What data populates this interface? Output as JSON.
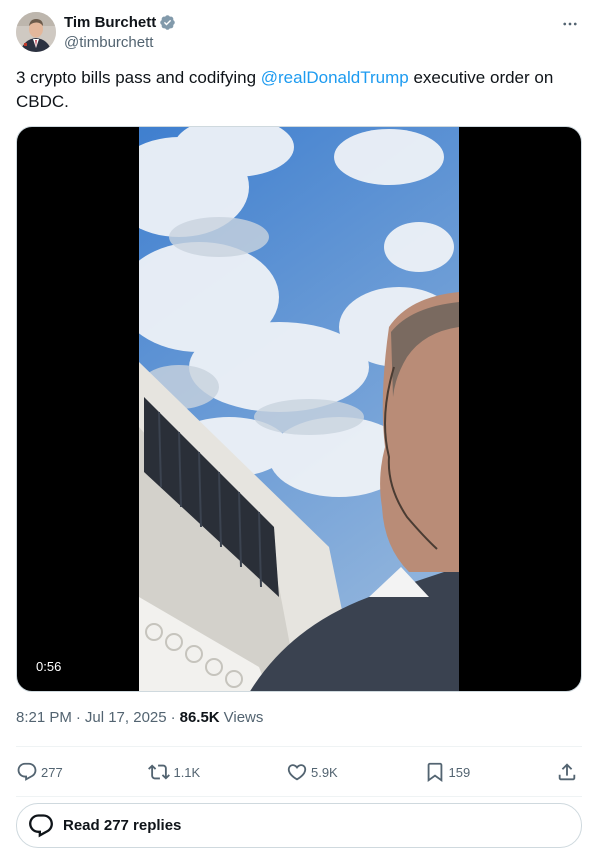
{
  "tweet": {
    "author": {
      "display_name": "Tim Burchett",
      "handle": "@timburchett",
      "verified": true
    },
    "text_before": "3 crypto bills pass and codifying ",
    "mention": "@realDonaldTrump",
    "text_after": " executive order on CBDC.",
    "video": {
      "duration": "0:56"
    },
    "meta": {
      "time": "8:21 PM",
      "sep1": "·",
      "date": "Jul 17, 2025",
      "sep2": "·",
      "views_count": "86.5K",
      "views_label": "Views"
    },
    "actions": {
      "replies": "277",
      "reposts": "1.1K",
      "likes": "5.9K",
      "bookmarks": "159"
    },
    "read_replies_label": "Read 277 replies"
  },
  "colors": {
    "accent": "#1d9bf0",
    "text": "#0f1419",
    "secondary": "#536471",
    "border": "#cfd9de"
  }
}
